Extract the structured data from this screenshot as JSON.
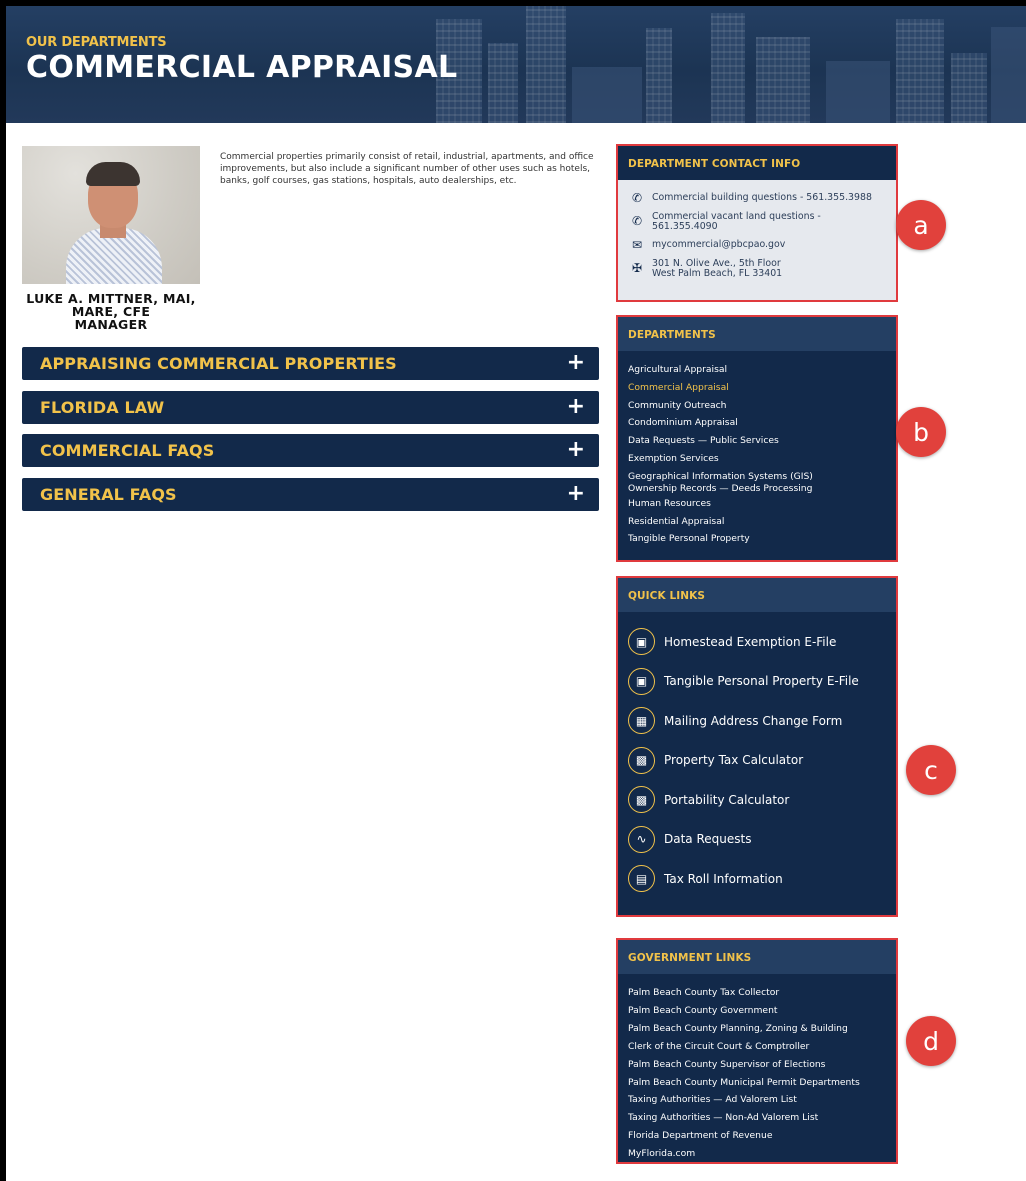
{
  "header": {
    "kicker": "OUR DEPARTMENTS",
    "title": "COMMERCIAL APPRAISAL"
  },
  "manager": {
    "name_line1": "LUKE A. MITTNER, MAI,",
    "name_line2": "MARE, CFE",
    "role": "MANAGER"
  },
  "intro": "Commercial properties primarily consist of retail, industrial, apartments, and office improvements, but also include a significant number of other uses such as hotels, banks, golf courses, gas stations, hospitals, auto dealerships, etc.",
  "accordions": [
    {
      "label": "APPRAISING COMMERCIAL PROPERTIES",
      "icon": "+"
    },
    {
      "label": "FLORIDA LAW",
      "icon": "+"
    },
    {
      "label": "COMMERCIAL FAQS",
      "icon": "+"
    },
    {
      "label": "GENERAL FAQS",
      "icon": "+"
    }
  ],
  "contact": {
    "heading": "DEPARTMENT CONTACT INFO",
    "building": "Commercial building questions - 561.355.3988",
    "land_line1": "Commercial vacant land questions -",
    "land_line2": "561.355.4090",
    "email": "mycommercial@pbcpao.gov",
    "address_line1": "301 N. Olive Ave., 5th Floor",
    "address_line2": "West Palm Beach, FL 33401"
  },
  "departments": {
    "heading": "DEPARTMENTS",
    "items": [
      "Agricultural Appraisal",
      "Commercial Appraisal",
      "Community Outreach",
      "Condominium Appraisal",
      "Data Requests — Public Services",
      "Exemption Services",
      "Geographical Information Systems (GIS)",
      "Ownership Records — Deeds Processing",
      "Human Resources",
      "Residential Appraisal",
      "Tangible Personal Property"
    ]
  },
  "quick_links": {
    "heading": "QUICK LINKS",
    "items": [
      "Homestead Exemption E-File",
      "Tangible Personal Property E-File",
      "Mailing Address Change Form",
      "Property Tax Calculator",
      "Portability Calculator",
      "Data Requests",
      "Tax Roll Information"
    ]
  },
  "government_links": {
    "heading": "GOVERNMENT LINKS",
    "items": [
      "Palm Beach County Tax Collector",
      "Palm Beach County Government",
      "Palm Beach County Planning, Zoning & Building",
      "Clerk of the Circuit Court & Comptroller",
      "Palm Beach County Supervisor of Elections",
      "Palm Beach County Municipal Permit Departments",
      "Taxing Authorities — Ad Valorem List",
      "Taxing Authorities — Non-Ad Valorem List",
      "Florida Department of Revenue",
      "MyFlorida.com"
    ]
  },
  "callouts": [
    "a",
    "b",
    "c",
    "d"
  ],
  "colors": {
    "navy": "#12294a",
    "gold": "#f1c24a",
    "highlight": "#e03a3e",
    "callout": "#e1413c"
  }
}
